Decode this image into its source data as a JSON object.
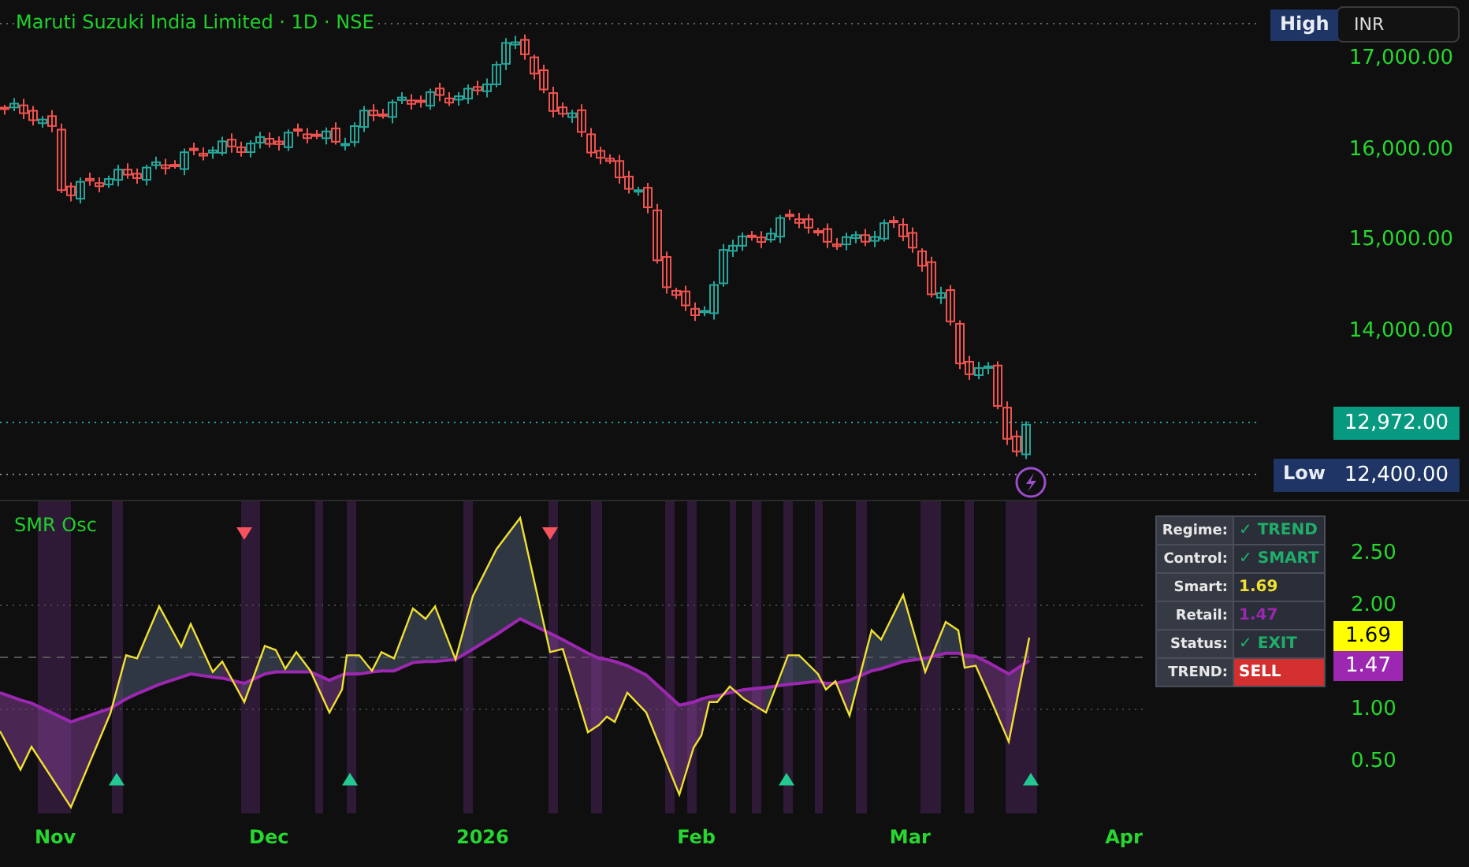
{
  "header": {
    "title": "Maruti Suzuki India Limited · 1D · NSE",
    "currency": "INR"
  },
  "price_axis": [
    "17,000.00",
    "16,000.00",
    "15,000.00",
    "14,000.00"
  ],
  "price_markers": [
    {
      "kind": "high",
      "label": "High"
    },
    {
      "kind": "last",
      "value": "12,972.00"
    },
    {
      "kind": "low",
      "label": "Low",
      "value": "12,400.00"
    }
  ],
  "oscillator": {
    "title": "SMR Osc",
    "value_axis": [
      "2.50",
      "2.00",
      "1.00",
      "0.50"
    ],
    "value_badges": [
      {
        "value": "1.69",
        "color": "#ffff00"
      },
      {
        "value": "1.47",
        "color": "#9c27b0"
      }
    ],
    "table": [
      {
        "label": "Regime:",
        "value": "✓ TREND",
        "kind": "text",
        "color": "#1fae6a"
      },
      {
        "label": "Control:",
        "value": "✓ SMART",
        "kind": "text",
        "color": "#1fae6a"
      },
      {
        "label": "Smart:",
        "value": "1.69",
        "kind": "text",
        "color": "#f0e030"
      },
      {
        "label": "Retail:",
        "value": "1.47",
        "kind": "text",
        "color": "#9c27b0"
      },
      {
        "label": "Status:",
        "value": "✓ EXIT",
        "kind": "text",
        "color": "#1fae6a"
      },
      {
        "label": "TREND:",
        "value": "SELL",
        "kind": "badge",
        "color": "#d32f2f"
      }
    ],
    "time_axis": [
      "Nov",
      "Dec",
      "2026",
      "Feb",
      "Mar",
      "Apr"
    ]
  }
}
